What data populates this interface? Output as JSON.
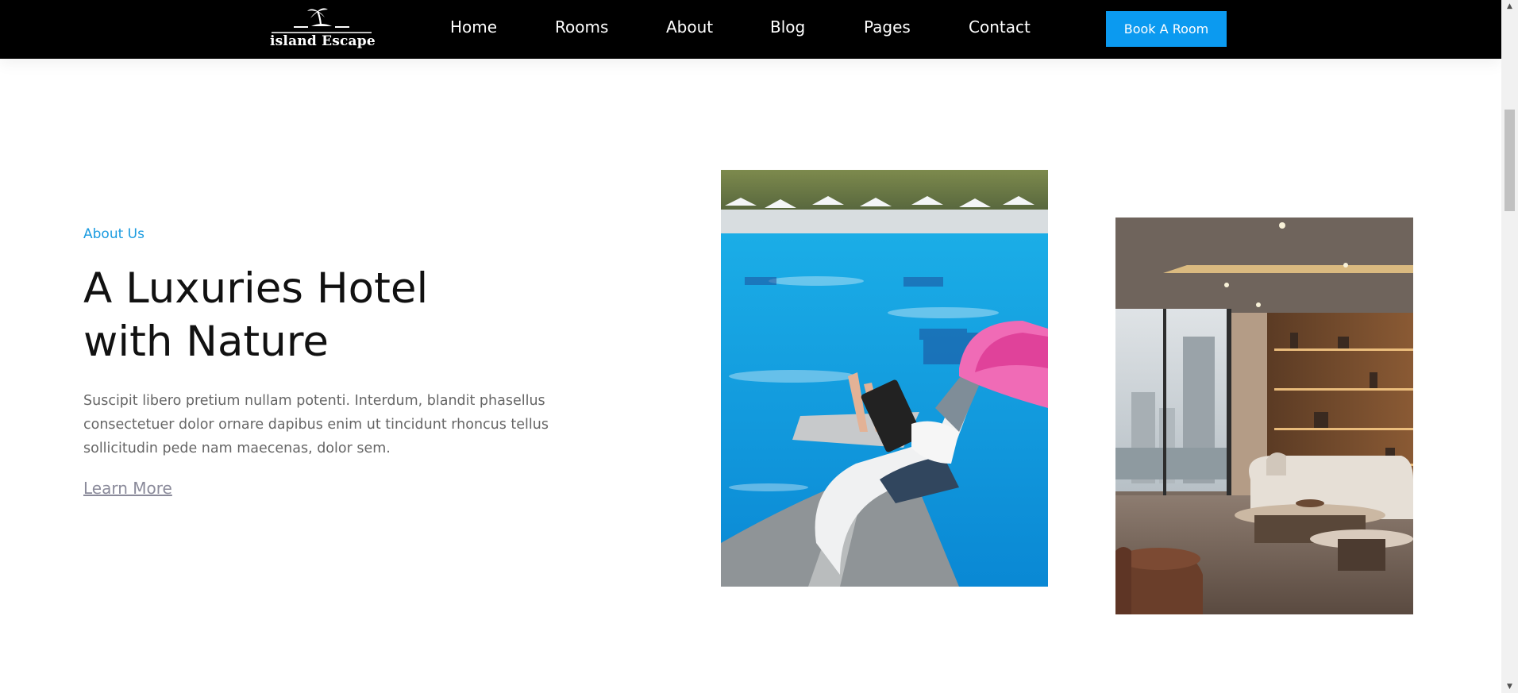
{
  "nav": {
    "logo_text": "island Escape",
    "items": [
      {
        "label": "Home"
      },
      {
        "label": "Rooms"
      },
      {
        "label": "About"
      },
      {
        "label": "Blog"
      },
      {
        "label": "Pages"
      },
      {
        "label": "Contact"
      }
    ],
    "cta_label": "Book A Room"
  },
  "about": {
    "eyebrow": "About Us",
    "headline_line1": "A Luxuries Hotel",
    "headline_line2": "with Nature",
    "description": "Suscipit libero pretium nullam potenti. Interdum, blandit phasellus consectetuer dolor ornare dapibus enim ut tincidunt rhoncus tellus sollicitudin pede nam maecenas, dolor sem.",
    "link_label": "Learn More"
  },
  "colors": {
    "nav_background": "#000000",
    "accent": "#0b9af0",
    "eyebrow_text": "#1a9be0",
    "body_text": "#666666",
    "heading_text": "#111111"
  },
  "icons": {
    "logo": "palm-island-icon",
    "scroll_up": "caret-up-icon",
    "scroll_down": "caret-down-icon"
  }
}
